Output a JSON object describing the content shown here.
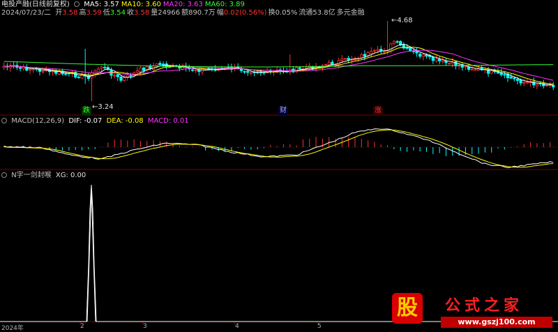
{
  "header": {
    "title": "电投产融(日线前复权)",
    "ma": [
      {
        "label": "MA5: 3.57",
        "color": "#ffffff"
      },
      {
        "label": "MA10: 3.60",
        "color": "#ffff00"
      },
      {
        "label": "MA20: 3.63",
        "color": "#ff33ff"
      },
      {
        "label": "MA60: 3.89",
        "color": "#33ff33"
      }
    ]
  },
  "quote": {
    "date": "2024/07/23/二",
    "items": [
      {
        "k": "开",
        "v": "3.58",
        "vc": "#ff3030"
      },
      {
        "k": "高",
        "v": "3.59",
        "vc": "#ff3030"
      },
      {
        "k": "低",
        "v": "3.54",
        "vc": "#33ff33"
      },
      {
        "k": "收",
        "v": "3.58",
        "vc": "#ff3030"
      },
      {
        "k": "量",
        "v": "24966",
        "vc": "#c0c0c0"
      },
      {
        "k": "额",
        "v": "890.7万",
        "vc": "#c0c0c0"
      },
      {
        "k": "幅",
        "v": "0.02(0.56%)",
        "vc": "#ff3030"
      },
      {
        "k": "换",
        "v": "0.05%",
        "vc": "#c0c0c0"
      },
      {
        "k": "流通",
        "v": "53.8亿",
        "vc": "#c0c0c0"
      },
      {
        "k": "",
        "v": "多元金融",
        "vc": "#c0c0c0"
      }
    ]
  },
  "annotations": {
    "high_label": "4.68",
    "low_label": "3.24",
    "tags": [
      {
        "text": "跌",
        "color": "#33ff33",
        "bg": "#003300"
      },
      {
        "text": "财",
        "color": "#aaaaff",
        "bg": "#000033"
      },
      {
        "text": "涨",
        "color": "#ff3030",
        "bg": "#330000"
      }
    ]
  },
  "macd": {
    "title": "MACD(12,26,9)",
    "dif": "DIF: -0.07",
    "dea": "DEA: -0.08",
    "macd": "MACD: 0.01",
    "colors": {
      "dif": "#ffffff",
      "dea": "#ffff00",
      "macd": "#ff33ff"
    }
  },
  "indicator": {
    "title": "N字一剑封喉",
    "xg": "XG: 0.00"
  },
  "xaxis": [
    "2024年",
    "2",
    "3",
    "4",
    "5"
  ],
  "logo": {
    "big": "股",
    "title": "公式之家",
    "url": "www.gszj100.com"
  },
  "colors": {
    "up": "#ff3030",
    "down": "#00ffff",
    "ma5": "#ffffff",
    "ma10": "#ffff00",
    "ma20": "#ff33ff",
    "ma60": "#33ff33",
    "divider": "#800000"
  }
}
